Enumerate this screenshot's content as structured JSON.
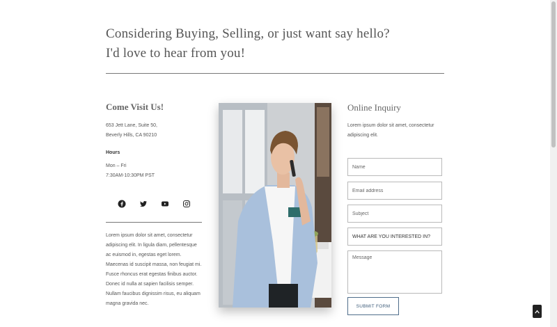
{
  "heading": {
    "line1": "Considering Buying, Selling, or just want say hello?",
    "line2": "I'd love to hear from you!"
  },
  "visit": {
    "title": "Come Visit Us!",
    "address_line1": "653 Jett Lane, Suite 50,",
    "address_line2": "Beverly Hills, CA 90210",
    "hours_title": "Hours",
    "hours_days": "Mon – Fri",
    "hours_time": "7:30AM-10:30PM PST",
    "social_icons": [
      "facebook-icon",
      "twitter-icon",
      "youtube-icon",
      "instagram-icon"
    ],
    "paragraph": "Lorem ipsum dolor sit amet, consectetur adipiscing elit. In ligula diam, pellentesque ac euismod in, egestas eget lorem. Maecenas id suscipit massa, non feugiat mi. Fusce rhoncus erat egestas finibus auctor. Donec id nulla at sapien facilisis semper. Nullam faucibus dignissim risus, eu aliquam magna gravida nec."
  },
  "inquiry": {
    "title": "Online Inquiry",
    "text": "Lorem ipsum dolor sit amet, consectetur adipiscing elit.",
    "name_placeholder": "Name",
    "email_placeholder": "Email address",
    "subject_placeholder": "Subject",
    "interest_label": "WHAT ARE YOU INTERESTED IN?",
    "message_placeholder": "Message",
    "submit_label": "SUBMIT FORM"
  },
  "colors": {
    "accent": "#3b5a78",
    "rule": "#777777",
    "text": "#555555"
  }
}
